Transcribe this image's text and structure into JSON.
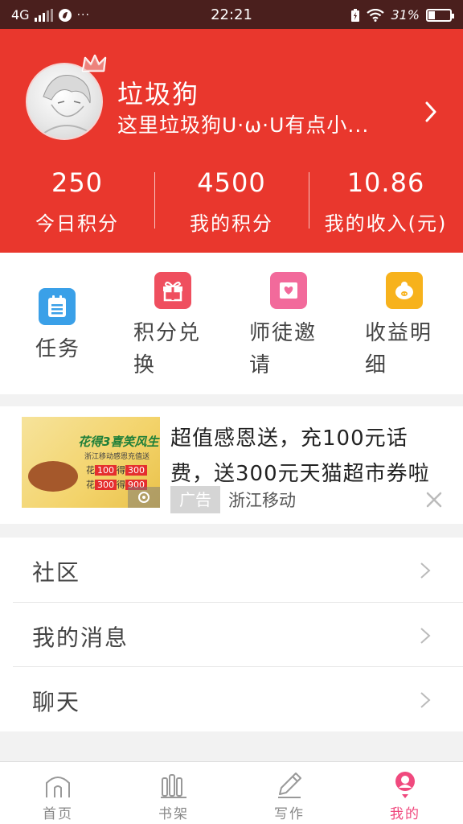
{
  "status_bar": {
    "network": "4G",
    "time": "22:21",
    "battery": "31%",
    "battery_level": 0.31,
    "more": "···"
  },
  "profile": {
    "username": "垃圾狗",
    "bio": "这里垃圾狗U·ω·U有点小...",
    "stats": [
      {
        "value": "250",
        "label": "今日积分"
      },
      {
        "value": "4500",
        "label": "我的积分"
      },
      {
        "value": "10.86",
        "label": "我的收入(元)"
      }
    ]
  },
  "quick_actions": [
    {
      "label": "任务",
      "icon": "task-list-icon",
      "color": "#3aa0e8"
    },
    {
      "label": "积分兑换",
      "icon": "gift-icon",
      "color": "#ef4f5f"
    },
    {
      "label": "师徒邀请",
      "icon": "heart-envelope-icon",
      "color": "#f26a9b"
    },
    {
      "label": "收益明细",
      "icon": "piggy-icon",
      "color": "#f7b21c"
    }
  ],
  "ad": {
    "title": "超值感恩送，充100元话费，送300元天猫超市券啦",
    "tag": "广告",
    "source": "浙江移动",
    "image_title": "花得3喜笑风生",
    "image_sub": "浙江移动感恩充值送",
    "image_rows": [
      {
        "a": "花",
        "b": "100",
        "c": "得",
        "d": "300"
      },
      {
        "a": "花",
        "b": "300",
        "c": "得",
        "d": "900"
      }
    ]
  },
  "menu": [
    {
      "label": "社区"
    },
    {
      "label": "我的消息"
    },
    {
      "label": "聊天"
    }
  ],
  "bottom_nav": [
    {
      "label": "首页",
      "icon": "home-icon"
    },
    {
      "label": "书架",
      "icon": "bookshelf-icon"
    },
    {
      "label": "写作",
      "icon": "pencil-icon"
    },
    {
      "label": "我的",
      "icon": "profile-icon",
      "active": true
    }
  ],
  "colors": {
    "header_red": "#e9372d",
    "status_bar": "#4a1f1d",
    "active_pink": "#f0497e"
  }
}
